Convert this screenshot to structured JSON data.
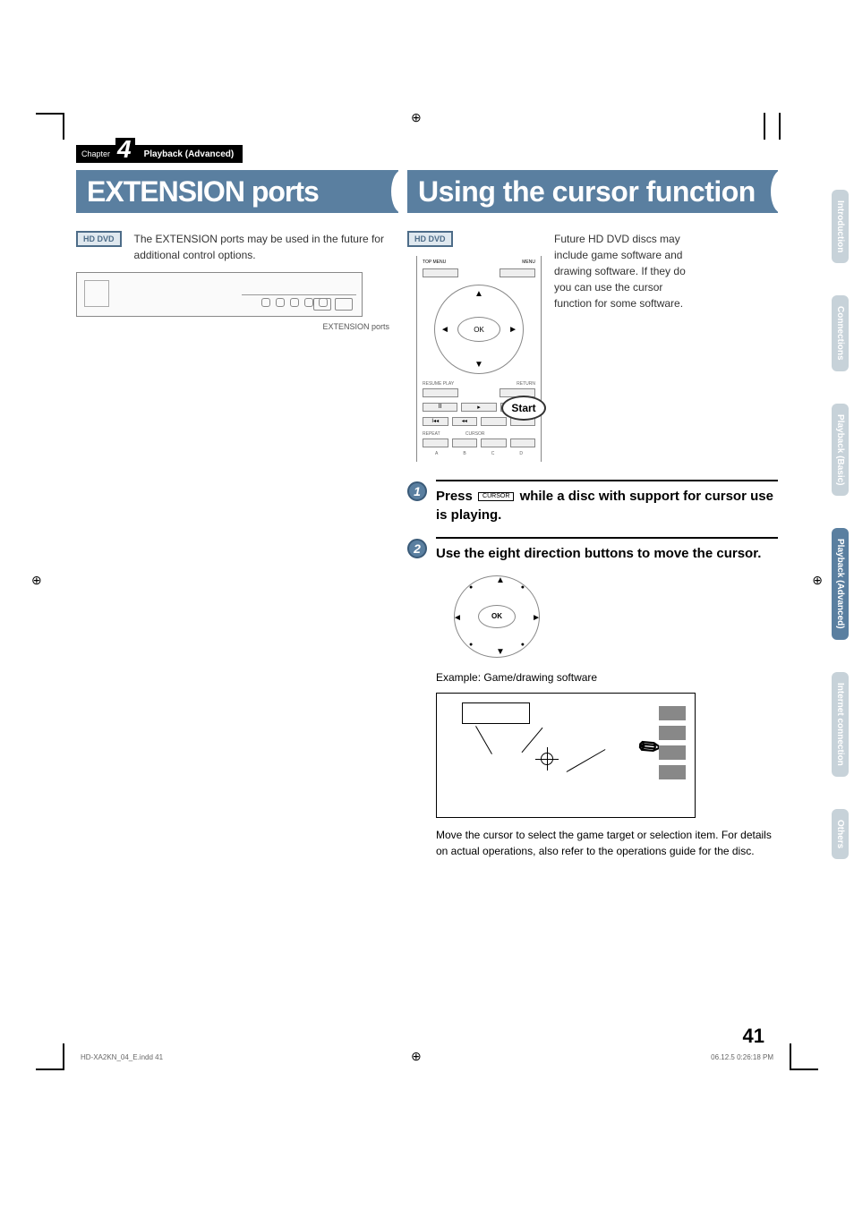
{
  "chapter": {
    "label": "Chapter",
    "number": "4",
    "title": "Playback (Advanced)"
  },
  "left": {
    "banner": "EXTENSION ports",
    "badge": "HD DVD",
    "intro": "The EXTENSION ports may be used in the future for additional control options.",
    "caption": "EXTENSION ports"
  },
  "right": {
    "banner": "Using the cursor function",
    "badge": "HD DVD",
    "intro": "Future HD DVD discs may include game software and drawing software. If they do you can use the cursor function for some software.",
    "remote": {
      "top_menu": "TOP MENU",
      "menu": "MENU",
      "ok": "OK",
      "resume_play": "RESUME PLAY",
      "return": "RETURN",
      "repeat": "REPEAT",
      "cursor": "CURSOR",
      "row_abcd": {
        "a": "A",
        "b": "B",
        "c": "C",
        "d": "D"
      },
      "start": "Start"
    },
    "steps": {
      "s1_pre": "Press ",
      "s1_btn": "CURSOR",
      "s1_post": " while a disc with support for cursor use is playing.",
      "s2": "Use the eight direction buttons to move the cursor.",
      "dir_ok": "OK",
      "example_label": "Example: Game/drawing software",
      "game_caption": "Move the cursor to select the game target or selection item. For details on actual operations, also refer to the operations guide for the disc."
    }
  },
  "side_tabs": {
    "t1": "Introduction",
    "t2": "Connections",
    "t3": "Playback (Basic)",
    "t4": "Playback (Advanced)",
    "t5": "Internet connection",
    "t6": "Others"
  },
  "page_number": "41",
  "footer": {
    "left": "HD-XA2KN_04_E.indd   41",
    "right": "06.12.5   0:26:18 PM"
  }
}
